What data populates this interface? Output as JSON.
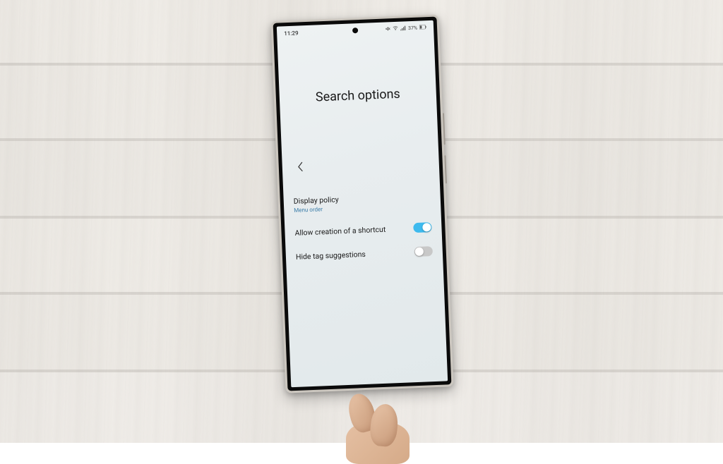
{
  "statusBar": {
    "time": "11:29",
    "battery": "37%"
  },
  "page": {
    "title": "Search options"
  },
  "settings": {
    "displayPolicy": {
      "label": "Display policy",
      "value": "Menu order"
    },
    "allowShortcut": {
      "label": "Allow creation of a shortcut",
      "enabled": true
    },
    "hideTagSuggestions": {
      "label": "Hide tag suggestions",
      "enabled": false
    }
  }
}
